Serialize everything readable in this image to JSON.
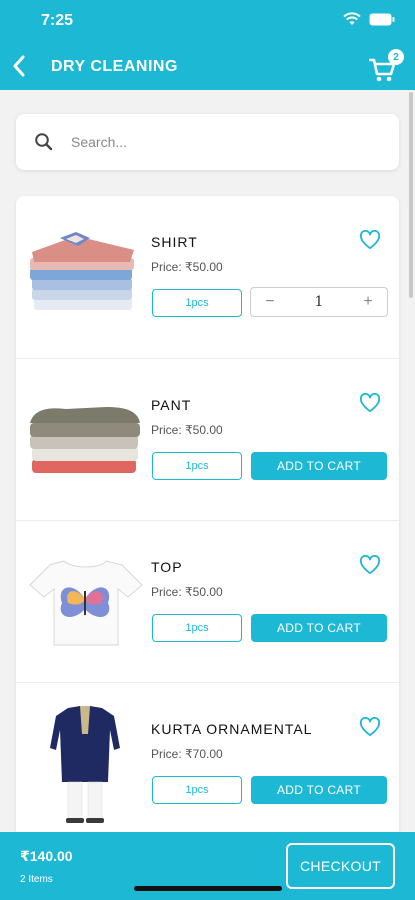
{
  "status": {
    "time": "7:25"
  },
  "header": {
    "title": "DRY CLEANING",
    "cart_count": "2",
    "icons": [
      "chevron-left-icon",
      "cart-icon"
    ]
  },
  "search": {
    "placeholder": "Search...",
    "value": ""
  },
  "products": [
    {
      "name": "SHIRT",
      "price": "Price: ₹50.00",
      "unit": "1pcs",
      "in_cart": true,
      "quantity": "1",
      "minus": "−",
      "plus": "+"
    },
    {
      "name": "PANT",
      "price": "Price: ₹50.00",
      "unit": "1pcs",
      "in_cart": false,
      "add_label": "ADD TO CART"
    },
    {
      "name": "TOP",
      "price": "Price: ₹50.00",
      "unit": "1pcs",
      "in_cart": false,
      "add_label": "ADD TO CART"
    },
    {
      "name": "KURTA ORNAMENTAL",
      "price": "Price: ₹70.00",
      "unit": "1pcs",
      "in_cart": false,
      "add_label": "ADD TO CART"
    }
  ],
  "footer": {
    "total": "₹140.00",
    "items": "2 Items",
    "checkout_label": "CHECKOUT"
  },
  "colors": {
    "accent": "#1cb8d4",
    "background": "#f2f2f2"
  }
}
